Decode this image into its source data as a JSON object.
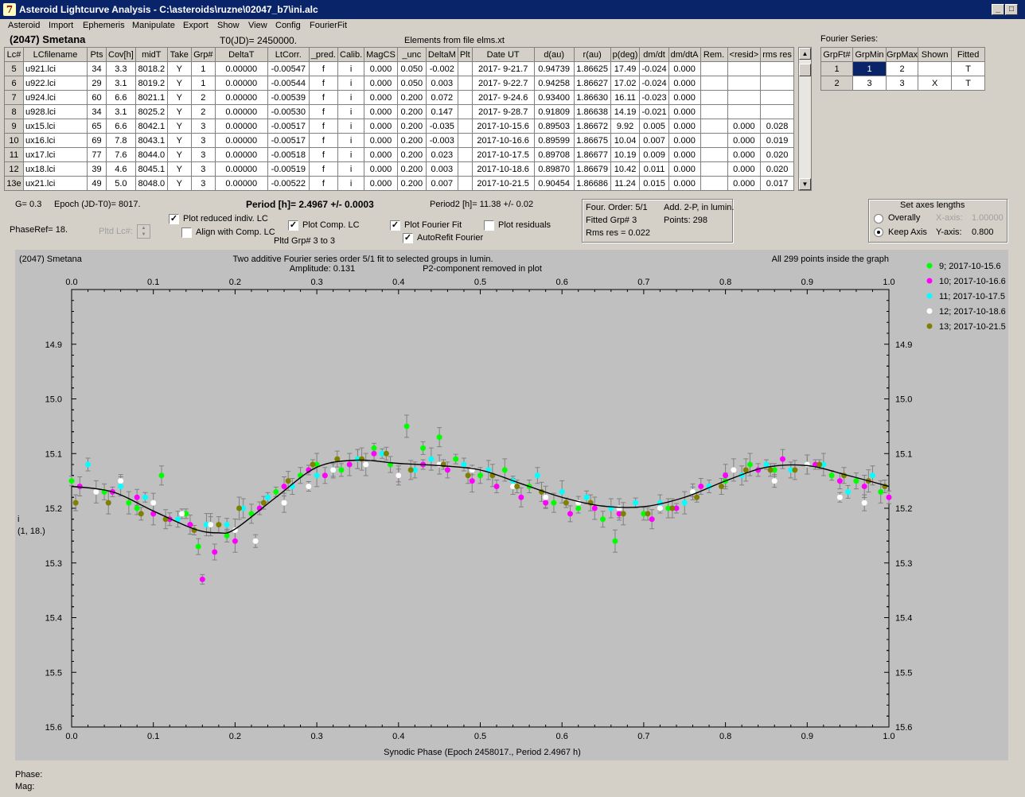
{
  "window": {
    "title": "Asteroid Lightcurve Analysis - C:\\asteroids\\ruzne\\02047_b7\\ini.alc",
    "icon": "app-icon",
    "buttons": [
      "_",
      "□",
      "×"
    ]
  },
  "menu": [
    "Asteroid",
    "Import",
    "Ephemeris",
    "Manipulate",
    "Export",
    "Show",
    "View",
    "Config",
    "FourierFit"
  ],
  "header": {
    "asteroid": "(2047) Smetana",
    "t0": "T0(JD)= 2450000.",
    "elements": "Elements from file elms.xt"
  },
  "lc_table": {
    "columns": [
      "Lc#",
      "LCfilename",
      "Pts",
      "Cov[h]",
      "midT",
      "Take",
      "Grp#",
      "DeltaT",
      "LtCorr.",
      "_pred.",
      "Calib.",
      "MagCS",
      "_unc",
      "DeltaM",
      "Plt",
      "Date UT",
      "d(au)",
      "r(au)",
      "p(deg)",
      "dm/dt",
      "dm/dtA",
      "Rem.",
      "<resid>",
      "rms res"
    ],
    "rows": [
      [
        "5",
        "u921.lci",
        "34",
        "3.3",
        "8018.2",
        "Y",
        "1",
        "0.00000",
        "-0.00547",
        "f",
        "i",
        "0.000",
        "0.050",
        "-0.002",
        "",
        "2017- 9-21.7",
        "0.94739",
        "1.86625",
        "17.49",
        "-0.024",
        "0.000",
        "",
        "",
        ""
      ],
      [
        "6",
        "u922.lci",
        "29",
        "3.1",
        "8019.2",
        "Y",
        "1",
        "0.00000",
        "-0.00544",
        "f",
        "i",
        "0.000",
        "0.050",
        "0.003",
        "",
        "2017- 9-22.7",
        "0.94258",
        "1.86627",
        "17.02",
        "-0.024",
        "0.000",
        "",
        "",
        ""
      ],
      [
        "7",
        "u924.lci",
        "60",
        "6.6",
        "8021.1",
        "Y",
        "2",
        "0.00000",
        "-0.00539",
        "f",
        "i",
        "0.000",
        "0.200",
        "0.072",
        "",
        "2017- 9-24.6",
        "0.93400",
        "1.86630",
        "16.11",
        "-0.023",
        "0.000",
        "",
        "",
        ""
      ],
      [
        "8",
        "u928.lci",
        "34",
        "3.1",
        "8025.2",
        "Y",
        "2",
        "0.00000",
        "-0.00530",
        "f",
        "i",
        "0.000",
        "0.200",
        "0.147",
        "",
        "2017- 9-28.7",
        "0.91809",
        "1.86638",
        "14.19",
        "-0.021",
        "0.000",
        "",
        "",
        ""
      ],
      [
        "9",
        "ux15.lci",
        "65",
        "6.6",
        "8042.1",
        "Y",
        "3",
        "0.00000",
        "-0.00517",
        "f",
        "i",
        "0.000",
        "0.200",
        "-0.035",
        "",
        "2017-10-15.6",
        "0.89503",
        "1.86672",
        "9.92",
        "0.005",
        "0.000",
        "",
        "0.000",
        "0.028"
      ],
      [
        "10",
        "ux16.lci",
        "69",
        "7.8",
        "8043.1",
        "Y",
        "3",
        "0.00000",
        "-0.00517",
        "f",
        "i",
        "0.000",
        "0.200",
        "-0.003",
        "",
        "2017-10-16.6",
        "0.89599",
        "1.86675",
        "10.04",
        "0.007",
        "0.000",
        "",
        "0.000",
        "0.019"
      ],
      [
        "11",
        "ux17.lci",
        "77",
        "7.6",
        "8044.0",
        "Y",
        "3",
        "0.00000",
        "-0.00518",
        "f",
        "i",
        "0.000",
        "0.200",
        "0.023",
        "",
        "2017-10-17.5",
        "0.89708",
        "1.86677",
        "10.19",
        "0.009",
        "0.000",
        "",
        "0.000",
        "0.020"
      ],
      [
        "12",
        "ux18.lci",
        "39",
        "4.6",
        "8045.1",
        "Y",
        "3",
        "0.00000",
        "-0.00519",
        "f",
        "i",
        "0.000",
        "0.200",
        "0.003",
        "",
        "2017-10-18.6",
        "0.89870",
        "1.86679",
        "10.42",
        "0.011",
        "0.000",
        "",
        "0.000",
        "0.020"
      ],
      [
        "13e",
        "ux21.lci",
        "49",
        "5.0",
        "8048.0",
        "Y",
        "3",
        "0.00000",
        "-0.00522",
        "f",
        "i",
        "0.000",
        "0.200",
        "0.007",
        "",
        "2017-10-21.5",
        "0.90454",
        "1.86686",
        "11.24",
        "0.015",
        "0.000",
        "",
        "0.000",
        "0.017"
      ]
    ]
  },
  "fourier_series": {
    "label": "Fourier Series:",
    "columns": [
      "GrpFt#",
      "GrpMin",
      "GrpMax",
      "Shown",
      "Fitted"
    ],
    "rows": [
      [
        "1",
        "1",
        "2",
        "",
        "T"
      ],
      [
        "2",
        "3",
        "3",
        "X",
        "T"
      ]
    ]
  },
  "info": {
    "g": "G= 0.3",
    "epoch": "Epoch (JD-T0)= 8017.",
    "period": "Period [h]= 2.4967 +/- 0.0003",
    "period2": "Period2 [h]= 11.38 +/- 0.02",
    "phaseref": "PhaseRef= 18.",
    "pltd_lc": "Pltd Lc#:",
    "pltd_grp": "Pltd Grp#   3   to    3"
  },
  "checkboxes": {
    "plot_reduced": {
      "label": "Plot reduced indiv. LC",
      "checked": true
    },
    "align_comp": {
      "label": "Align with Comp. LC",
      "checked": false
    },
    "plot_comp": {
      "label": "Plot Comp. LC",
      "checked": true
    },
    "plot_fourier": {
      "label": "Plot Fourier Fit",
      "checked": true
    },
    "autorefit": {
      "label": "AutoRefit Fourier",
      "checked": true
    },
    "plot_residuals": {
      "label": "Plot residuals",
      "checked": false
    }
  },
  "fit_box": {
    "order": "Four. Order:  5/1",
    "add": "Add. 2-P, in lumin.",
    "fitted_grp": "Fitted Grp# 3",
    "points": "Points: 298",
    "rms": "Rms res     = 0.022"
  },
  "axes_box": {
    "title": "Set axes lengths",
    "overally": "Overally",
    "keep_axis": "Keep Axis",
    "xaxis_label": "X-axis:",
    "xaxis_value": "1.00000",
    "yaxis_label": "Y-axis:",
    "yaxis_value": "0.800",
    "selected": "Keep Axis"
  },
  "plot": {
    "top_left": "(2047) Smetana",
    "top_center_1": "Two additive Fourier series order 5/1 fit to selected groups in lumin.",
    "top_center_2": "Amplitude: 0.131",
    "top_center_3": "P2-component removed in plot",
    "top_right": "All 299 points inside the graph",
    "ylabel_1": "i",
    "ylabel_2": "(1, 18.)",
    "xlabel": "Synodic Phase (Epoch 2458017., Period 2.4967 h)"
  },
  "chart_data": {
    "type": "scatter",
    "xlim": [
      0.0,
      1.0
    ],
    "ylim": [
      14.8,
      15.6
    ],
    "y_inverted": true,
    "xticks": [
      "0.0",
      "0.1",
      "0.2",
      "0.3",
      "0.4",
      "0.5",
      "0.6",
      "0.7",
      "0.8",
      "0.9",
      "1.0"
    ],
    "yticks": [
      "14.9",
      "15.0",
      "15.1",
      "15.2",
      "15.3",
      "15.4",
      "15.5",
      "15.6"
    ],
    "grid": false,
    "legend_position": "right",
    "fit_curve": {
      "x": [
        0.0,
        0.05,
        0.1,
        0.15,
        0.18,
        0.2,
        0.25,
        0.3,
        0.35,
        0.4,
        0.45,
        0.5,
        0.55,
        0.6,
        0.65,
        0.7,
        0.75,
        0.8,
        0.85,
        0.9,
        0.95,
        1.0
      ],
      "y": [
        15.16,
        15.17,
        15.205,
        15.238,
        15.245,
        15.238,
        15.18,
        15.125,
        15.112,
        15.118,
        15.122,
        15.13,
        15.155,
        15.18,
        15.196,
        15.197,
        15.18,
        15.15,
        15.125,
        15.122,
        15.14,
        15.16
      ]
    },
    "series": [
      {
        "name": "9; 2017-10-15.6",
        "color": "#00ff00",
        "x": [
          0.0,
          0.04,
          0.07,
          0.08,
          0.11,
          0.14,
          0.155,
          0.17,
          0.19,
          0.22,
          0.25,
          0.28,
          0.3,
          0.33,
          0.35,
          0.37,
          0.39,
          0.41,
          0.43,
          0.45,
          0.47,
          0.5,
          0.53,
          0.56,
          0.59,
          0.62,
          0.65,
          0.665,
          0.7,
          0.73,
          0.76,
          0.8,
          0.83,
          0.86,
          0.9,
          0.93,
          0.96,
          0.99
        ],
        "y": [
          15.15,
          15.17,
          15.19,
          15.2,
          15.14,
          15.21,
          15.27,
          15.23,
          15.25,
          15.21,
          15.17,
          15.14,
          15.12,
          15.13,
          15.11,
          15.09,
          15.12,
          15.05,
          15.09,
          15.07,
          15.11,
          15.14,
          15.13,
          15.16,
          15.19,
          15.2,
          15.22,
          15.26,
          15.21,
          15.2,
          15.17,
          15.15,
          15.12,
          15.13,
          15.12,
          15.14,
          15.15,
          15.17
        ]
      },
      {
        "name": "10; 2017-10-16.6",
        "color": "#ff00ff",
        "x": [
          0.01,
          0.05,
          0.08,
          0.1,
          0.12,
          0.145,
          0.16,
          0.175,
          0.2,
          0.23,
          0.26,
          0.29,
          0.31,
          0.34,
          0.37,
          0.4,
          0.43,
          0.46,
          0.49,
          0.52,
          0.55,
          0.58,
          0.61,
          0.64,
          0.67,
          0.71,
          0.74,
          0.77,
          0.8,
          0.84,
          0.87,
          0.91,
          0.94,
          0.97,
          1.0
        ],
        "y": [
          15.16,
          15.17,
          15.18,
          15.21,
          15.22,
          15.23,
          15.33,
          15.28,
          15.26,
          15.2,
          15.16,
          15.13,
          15.14,
          15.12,
          15.1,
          15.14,
          15.12,
          15.13,
          15.15,
          15.16,
          15.18,
          15.19,
          15.21,
          15.2,
          15.21,
          15.22,
          15.2,
          15.16,
          15.14,
          15.13,
          15.11,
          15.12,
          15.15,
          15.16,
          15.18
        ]
      },
      {
        "name": "11; 2017-10-17.5",
        "color": "#00ffff",
        "x": [
          0.02,
          0.06,
          0.09,
          0.13,
          0.165,
          0.19,
          0.21,
          0.24,
          0.27,
          0.3,
          0.32,
          0.35,
          0.38,
          0.42,
          0.44,
          0.48,
          0.51,
          0.54,
          0.57,
          0.6,
          0.63,
          0.66,
          0.69,
          0.72,
          0.75,
          0.78,
          0.82,
          0.85,
          0.88,
          0.92,
          0.95,
          0.98
        ],
        "y": [
          15.12,
          15.16,
          15.18,
          15.22,
          15.23,
          15.23,
          15.2,
          15.18,
          15.16,
          15.14,
          15.13,
          15.11,
          15.1,
          15.13,
          15.11,
          15.12,
          15.13,
          15.15,
          15.14,
          15.17,
          15.18,
          15.2,
          15.19,
          15.19,
          15.19,
          15.16,
          15.14,
          15.12,
          15.13,
          15.12,
          15.17,
          15.14
        ]
      },
      {
        "name": "12; 2017-10-18.6",
        "color": "#ffffff",
        "x": [
          0.03,
          0.06,
          0.1,
          0.135,
          0.17,
          0.2,
          0.225,
          0.26,
          0.29,
          0.32,
          0.36,
          0.4,
          0.45,
          0.49,
          0.54,
          0.58,
          0.62,
          0.67,
          0.72,
          0.76,
          0.81,
          0.86,
          0.9,
          0.94,
          0.97
        ],
        "y": [
          15.17,
          15.15,
          15.19,
          15.21,
          15.23,
          15.24,
          15.26,
          15.19,
          15.16,
          15.13,
          15.12,
          15.14,
          15.12,
          15.13,
          15.16,
          15.18,
          15.19,
          15.2,
          15.2,
          15.17,
          15.13,
          15.15,
          15.12,
          15.18,
          15.19
        ]
      },
      {
        "name": "13; 2017-10-21.5",
        "color": "#808000",
        "x": [
          0.005,
          0.045,
          0.085,
          0.115,
          0.15,
          0.18,
          0.205,
          0.235,
          0.265,
          0.295,
          0.325,
          0.355,
          0.385,
          0.415,
          0.455,
          0.485,
          0.515,
          0.545,
          0.575,
          0.605,
          0.635,
          0.675,
          0.705,
          0.735,
          0.765,
          0.795,
          0.825,
          0.855,
          0.885,
          0.915,
          0.945,
          0.975,
          0.995
        ],
        "y": [
          15.19,
          15.19,
          15.21,
          15.22,
          15.24,
          15.23,
          15.2,
          15.19,
          15.15,
          15.12,
          15.11,
          15.11,
          15.1,
          15.13,
          15.12,
          15.14,
          15.14,
          15.16,
          15.17,
          15.19,
          15.19,
          15.21,
          15.21,
          15.2,
          15.18,
          15.16,
          15.13,
          15.13,
          15.13,
          15.12,
          15.14,
          15.15,
          15.16
        ]
      }
    ]
  },
  "status": {
    "phase_label": "Phase:",
    "mag_label": "Mag:"
  }
}
